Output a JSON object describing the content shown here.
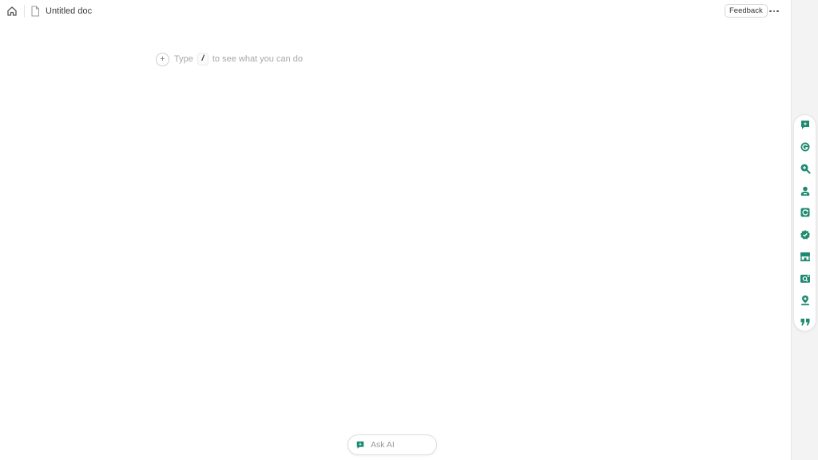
{
  "header": {
    "home_icon": "home-icon",
    "doc_icon": "file-icon",
    "title": "Untitled doc",
    "feedback_label": "Feedback",
    "more_icon": "more-horizontal-icon"
  },
  "editor": {
    "add_icon": "plus-icon",
    "add_symbol": "+",
    "placeholder_before": "Type",
    "slash_key": "/",
    "placeholder_after": "to see what you can do"
  },
  "toolbar": {
    "accent_color": "#1f8a70",
    "tools": [
      {
        "icon": "chat-sparkle-icon"
      },
      {
        "icon": "grammar-check-icon"
      },
      {
        "icon": "zoom-search-icon"
      },
      {
        "icon": "user-profile-icon"
      },
      {
        "icon": "refresh-doc-icon"
      },
      {
        "icon": "verified-badge-icon"
      },
      {
        "icon": "store-icon"
      },
      {
        "icon": "image-search-icon"
      },
      {
        "icon": "location-pin-icon"
      },
      {
        "icon": "quote-icon"
      }
    ]
  },
  "ask_ai": {
    "icon": "chat-sparkle-icon",
    "label": "Ask AI"
  }
}
